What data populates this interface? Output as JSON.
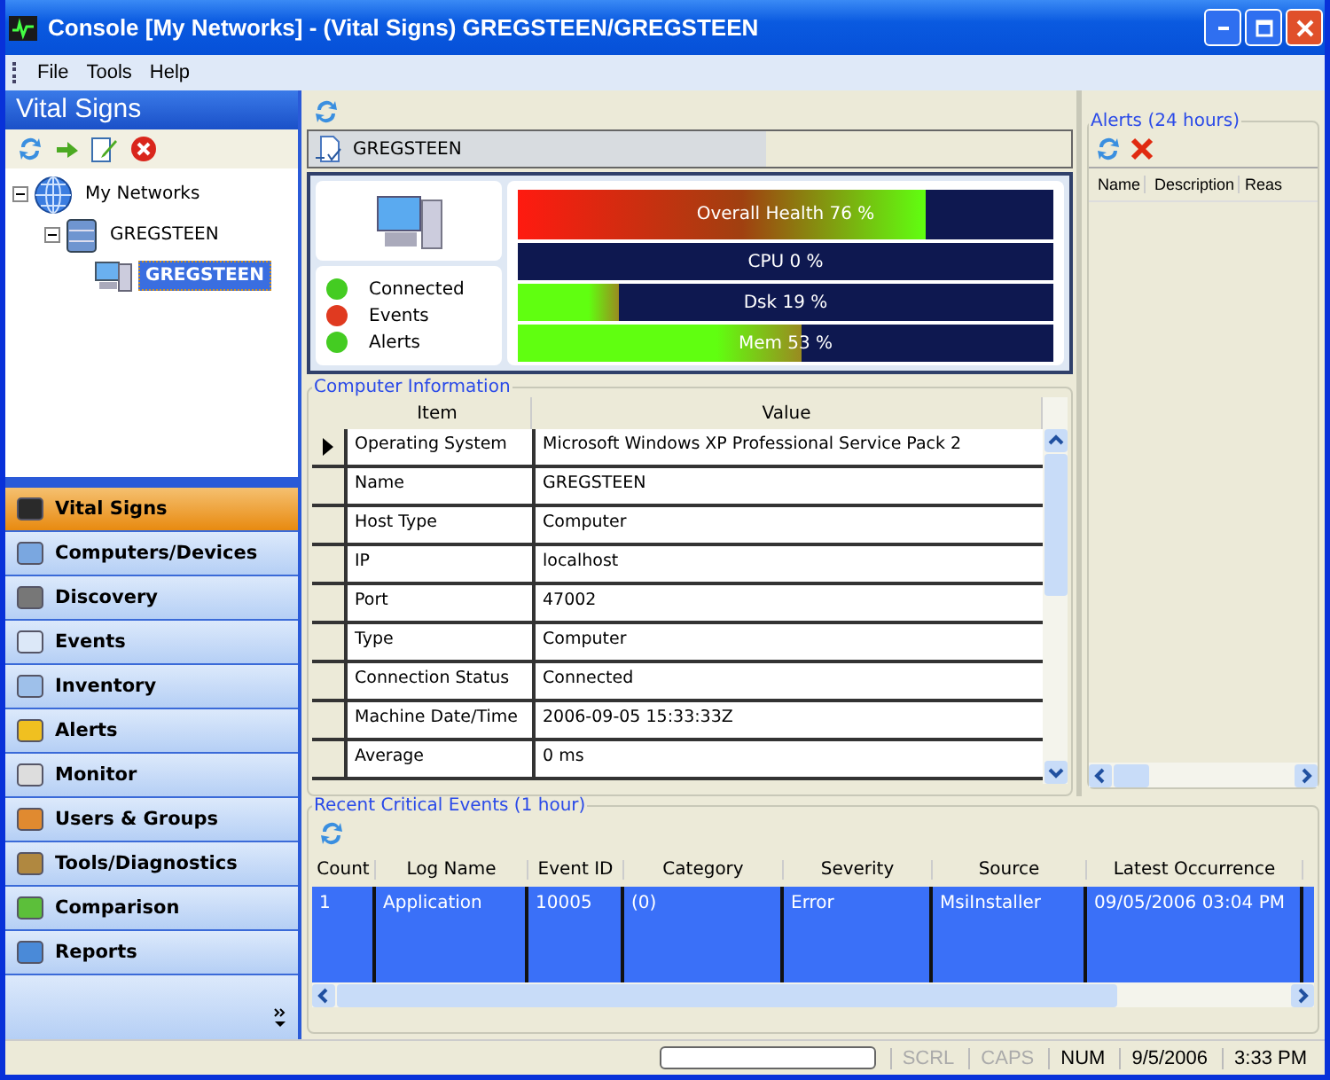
{
  "window": {
    "title": "Console [My Networks] - (Vital Signs) GREGSTEEN/GREGSTEEN"
  },
  "menu": [
    "File",
    "Tools",
    "Help"
  ],
  "sidebar": {
    "title": "Vital Signs",
    "tree": [
      {
        "label": "My Networks",
        "kind": "network",
        "expanded": true,
        "selected": false,
        "children": [
          {
            "label": "GREGSTEEN",
            "kind": "server",
            "expanded": true,
            "selected": false,
            "children": [
              {
                "label": "GREGSTEEN",
                "kind": "computer",
                "selected": true
              }
            ]
          }
        ]
      }
    ],
    "nav": [
      {
        "label": "Vital Signs",
        "selected": true
      },
      {
        "label": "Computers/Devices",
        "selected": false
      },
      {
        "label": "Discovery",
        "selected": false
      },
      {
        "label": "Events",
        "selected": false
      },
      {
        "label": "Inventory",
        "selected": false
      },
      {
        "label": "Alerts",
        "selected": false
      },
      {
        "label": "Monitor",
        "selected": false
      },
      {
        "label": "Users & Groups",
        "selected": false
      },
      {
        "label": "Tools/Diagnostics",
        "selected": false
      },
      {
        "label": "Comparison",
        "selected": false
      },
      {
        "label": "Reports",
        "selected": false
      }
    ]
  },
  "device": {
    "name": "GREGSTEEN"
  },
  "status_lights": [
    {
      "label": "Connected",
      "color": "#44cc22"
    },
    {
      "label": "Events",
      "color": "#e03a20"
    },
    {
      "label": "Alerts",
      "color": "#44cc22"
    }
  ],
  "meters": [
    {
      "label": "Overall Health 76 %",
      "kind": "health",
      "level": 0.76
    },
    {
      "label": "CPU 0 %",
      "kind": "usage",
      "level": 0
    },
    {
      "label": "Dsk 19 %",
      "kind": "usage",
      "level": 0.19
    },
    {
      "label": "Mem 53 %",
      "kind": "usage",
      "level": 0.53
    }
  ],
  "computer_info": {
    "title": "Computer Information",
    "columns": [
      "Item",
      "Value"
    ],
    "rows": [
      {
        "item": "Operating System",
        "value": "Microsoft Windows XP Professional Service Pack 2",
        "selected": true
      },
      {
        "item": "Name",
        "value": "GREGSTEEN",
        "selected": false
      },
      {
        "item": "Host Type",
        "value": "Computer",
        "selected": false
      },
      {
        "item": "IP",
        "value": "localhost",
        "selected": false
      },
      {
        "item": "Port",
        "value": "47002",
        "selected": false
      },
      {
        "item": "Type",
        "value": "Computer",
        "selected": false
      },
      {
        "item": "Connection Status",
        "value": "Connected",
        "selected": false
      },
      {
        "item": "Machine Date/Time",
        "value": "2006-09-05 15:33:33Z",
        "selected": false
      },
      {
        "item": "Average",
        "value": "0 ms",
        "selected": false
      }
    ]
  },
  "alerts": {
    "title": "Alerts (24 hours)",
    "columns": [
      "Name",
      "Description",
      "Reas"
    ]
  },
  "events": {
    "title": "Recent Critical Events (1 hour)",
    "columns": [
      "Count",
      "Log Name",
      "Event ID",
      "Category",
      "Severity",
      "Source",
      "Latest Occurrence"
    ],
    "rows": [
      {
        "cells": [
          "1",
          "Application",
          "10005",
          "(0)",
          "Error",
          "MsiInstaller",
          "09/05/2006 03:04 PM"
        ],
        "selected": true
      }
    ]
  },
  "progress": {
    "level": 0
  },
  "status_bar": [
    {
      "label": "SCRL",
      "disabled": true
    },
    {
      "label": "CAPS",
      "disabled": true
    },
    {
      "label": "NUM",
      "disabled": false
    },
    {
      "label": "9/5/2006",
      "disabled": false
    },
    {
      "label": "3:33 PM",
      "disabled": false
    }
  ]
}
